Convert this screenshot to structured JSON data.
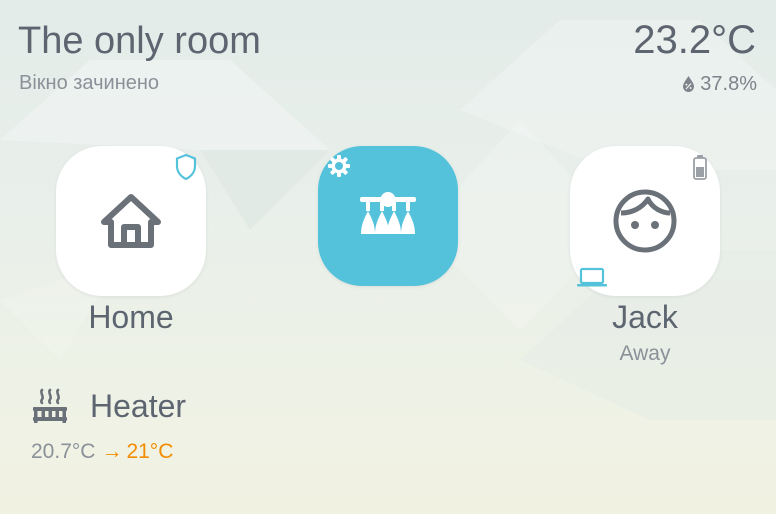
{
  "room": {
    "title": "The only room",
    "status": "Вікно зачинено",
    "temperature": "23.2°C",
    "humidity": "37.8%"
  },
  "tiles": {
    "home": {
      "label": "Home",
      "icon": "home-icon",
      "badge": "shield-icon"
    },
    "light": {
      "icon": "chandelier-icon",
      "badge": "gear-icon",
      "color": "#55c2db"
    },
    "jack": {
      "label": "Jack",
      "status": "Away",
      "icon": "face-icon",
      "badges": [
        "battery-icon",
        "laptop-icon"
      ]
    }
  },
  "heater": {
    "name": "Heater",
    "current": "20.7°C",
    "arrow": "→",
    "target": "21°C",
    "icon": "heater-icon"
  },
  "colors": {
    "accent": "#55c2db",
    "heating": "#f28c00",
    "text": "#5d6570",
    "muted": "#8a9199"
  }
}
